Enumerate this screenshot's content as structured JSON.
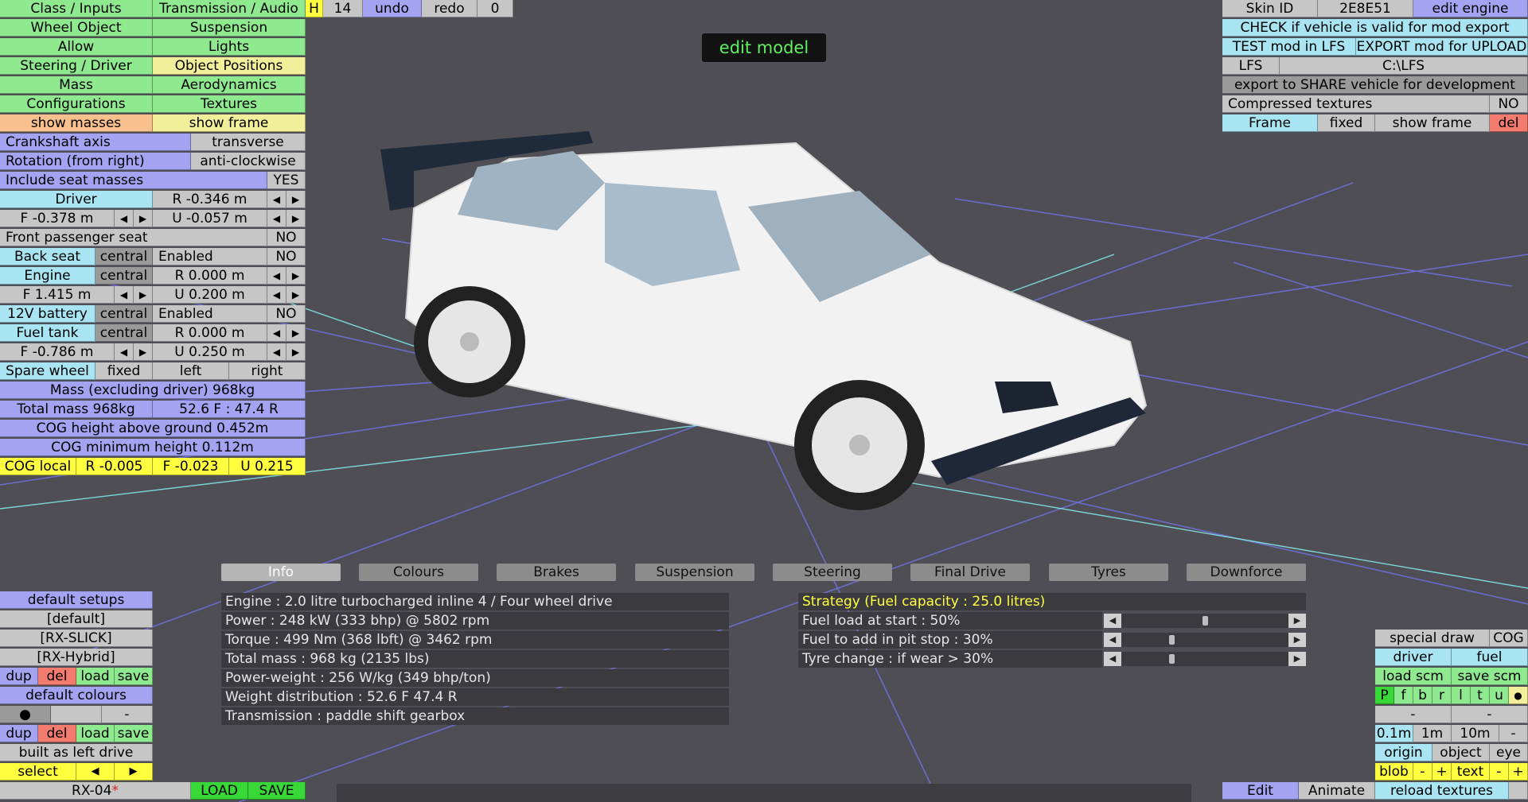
{
  "title_badge": "edit model",
  "top_row": {
    "h": "H",
    "count": "14",
    "undo": "undo",
    "redo": "redo",
    "zero": "0"
  },
  "left_menu": {
    "class_inputs": "Class / Inputs",
    "transmission_audio": "Transmission / Audio",
    "wheel_object": "Wheel Object",
    "suspension": "Suspension",
    "allow": "Allow",
    "lights": "Lights",
    "steering_driver": "Steering / Driver",
    "object_positions": "Object Positions",
    "mass": "Mass",
    "aerodynamics": "Aerodynamics",
    "configurations": "Configurations",
    "textures": "Textures",
    "show_masses": "show masses",
    "show_frame": "show frame"
  },
  "props": {
    "crankshaft_label": "Crankshaft axis",
    "crankshaft_value": "transverse",
    "rotation_label": "Rotation (from right)",
    "rotation_value": "anti-clockwise",
    "seat_masses_label": "Include seat masses",
    "seat_masses_value": "YES",
    "driver": "Driver",
    "driver_r": "R -0.346 m",
    "driver_f": "F -0.378 m",
    "driver_u": "U -0.057 m",
    "front_pass": "Front passenger seat",
    "front_pass_value": "NO",
    "back_seat": "Back seat",
    "central": "central",
    "enabled": "Enabled",
    "no": "NO",
    "engine": "Engine",
    "engine_r": "R 0.000 m",
    "engine_f": "F 1.415 m",
    "engine_u": "U 0.200 m",
    "battery": "12V battery",
    "fuel_tank": "Fuel tank",
    "fuel_r": "R 0.000 m",
    "fuel_f": "F -0.786 m",
    "fuel_u": "U 0.250 m",
    "spare_wheel": "Spare wheel",
    "fixed": "fixed",
    "left": "left",
    "right": "right",
    "mass_excl": "Mass (excluding driver) 968kg",
    "total_mass": "Total mass 968kg",
    "mass_dist": "52.6 F : 47.4 R",
    "cog_height": "COG height above ground 0.452m",
    "cog_min": "COG minimum height 0.112m",
    "cog_local": "COG local",
    "cog_r": "R -0.005",
    "cog_f": "F -0.023",
    "cog_u": "U 0.215",
    "arrow_left": "◀",
    "arrow_right": "▶"
  },
  "right_panel": {
    "skin_id": "Skin ID",
    "skin_value": "2E8E51",
    "edit_engine": "edit engine",
    "check_valid": "CHECK if vehicle is valid for mod export",
    "test_mod": "TEST mod in LFS",
    "export_upload": "EXPORT mod for UPLOAD",
    "lfs": "LFS",
    "lfs_path": "C:\\LFS",
    "export_share": "export to SHARE vehicle for development",
    "compressed": "Compressed textures",
    "compressed_value": "NO",
    "frame": "Frame",
    "fixed": "fixed",
    "show_frame": "show frame",
    "del": "del"
  },
  "tabs": [
    "Info",
    "Colours",
    "Brakes",
    "Suspension",
    "Steering",
    "Final Drive",
    "Tyres",
    "Downforce"
  ],
  "info_lines": [
    "Engine : 2.0 litre turbocharged inline 4 / Four wheel drive",
    "Power : 248 kW (333 bhp) @ 5802 rpm",
    "Torque : 499 Nm (368 lbft) @ 3462 rpm",
    "Total mass : 968 kg (2135 lbs)",
    "Power-weight : 256 W/kg (349 bhp/ton)",
    "Weight distribution : 52.6 F  47.4 R",
    "Transmission : paddle shift gearbox"
  ],
  "strategy": {
    "title": "Strategy (Fuel capacity : 25.0 litres)",
    "fuel_start": "Fuel load at start : 50%",
    "fuel_pit": "Fuel to add in pit stop : 30%",
    "tyre_change": "Tyre change : if wear > 30%",
    "fuel_start_level": 0.5,
    "fuel_pit_level": 0.3,
    "tyre_change_level": 0.3,
    "left": "◀",
    "right": "▶"
  },
  "setups": {
    "default_setups": "default setups",
    "items": [
      "[default]",
      "[RX-SLICK]",
      "[RX-Hybrid]"
    ],
    "dup": "dup",
    "del": "del",
    "load": "load",
    "save": "save",
    "default_colours": "default colours",
    "dot": "●",
    "dash": "-",
    "built_left": "built as left drive",
    "select": "select",
    "arrow_left": "◀",
    "arrow_right": "▶"
  },
  "bottom_left": {
    "model": "RX-04",
    "modified_marker": "*",
    "load": "LOAD",
    "save": "SAVE"
  },
  "bottom_right": {
    "special_draw": "special draw",
    "cog": "COG",
    "driver": "driver",
    "fuel": "fuel",
    "load_scm": "load scm",
    "save_scm": "save scm",
    "letters": [
      "P",
      "f",
      "b",
      "r",
      "l",
      "t",
      "u",
      "●"
    ],
    "dash": "-",
    "d01": "0.1m",
    "d1": "1m",
    "d10": "10m",
    "origin": "origin",
    "object": "object",
    "eye": "eye",
    "blob": "blob",
    "minus": "-",
    "plus": "+",
    "text": "text",
    "edit": "Edit",
    "animate": "Animate",
    "reload": "reload textures"
  },
  "colors": {
    "accent_green": "#8fe98f",
    "purple": "#a3a3f2",
    "cyan": "#a8e4f2",
    "background": "#4e4e54"
  }
}
